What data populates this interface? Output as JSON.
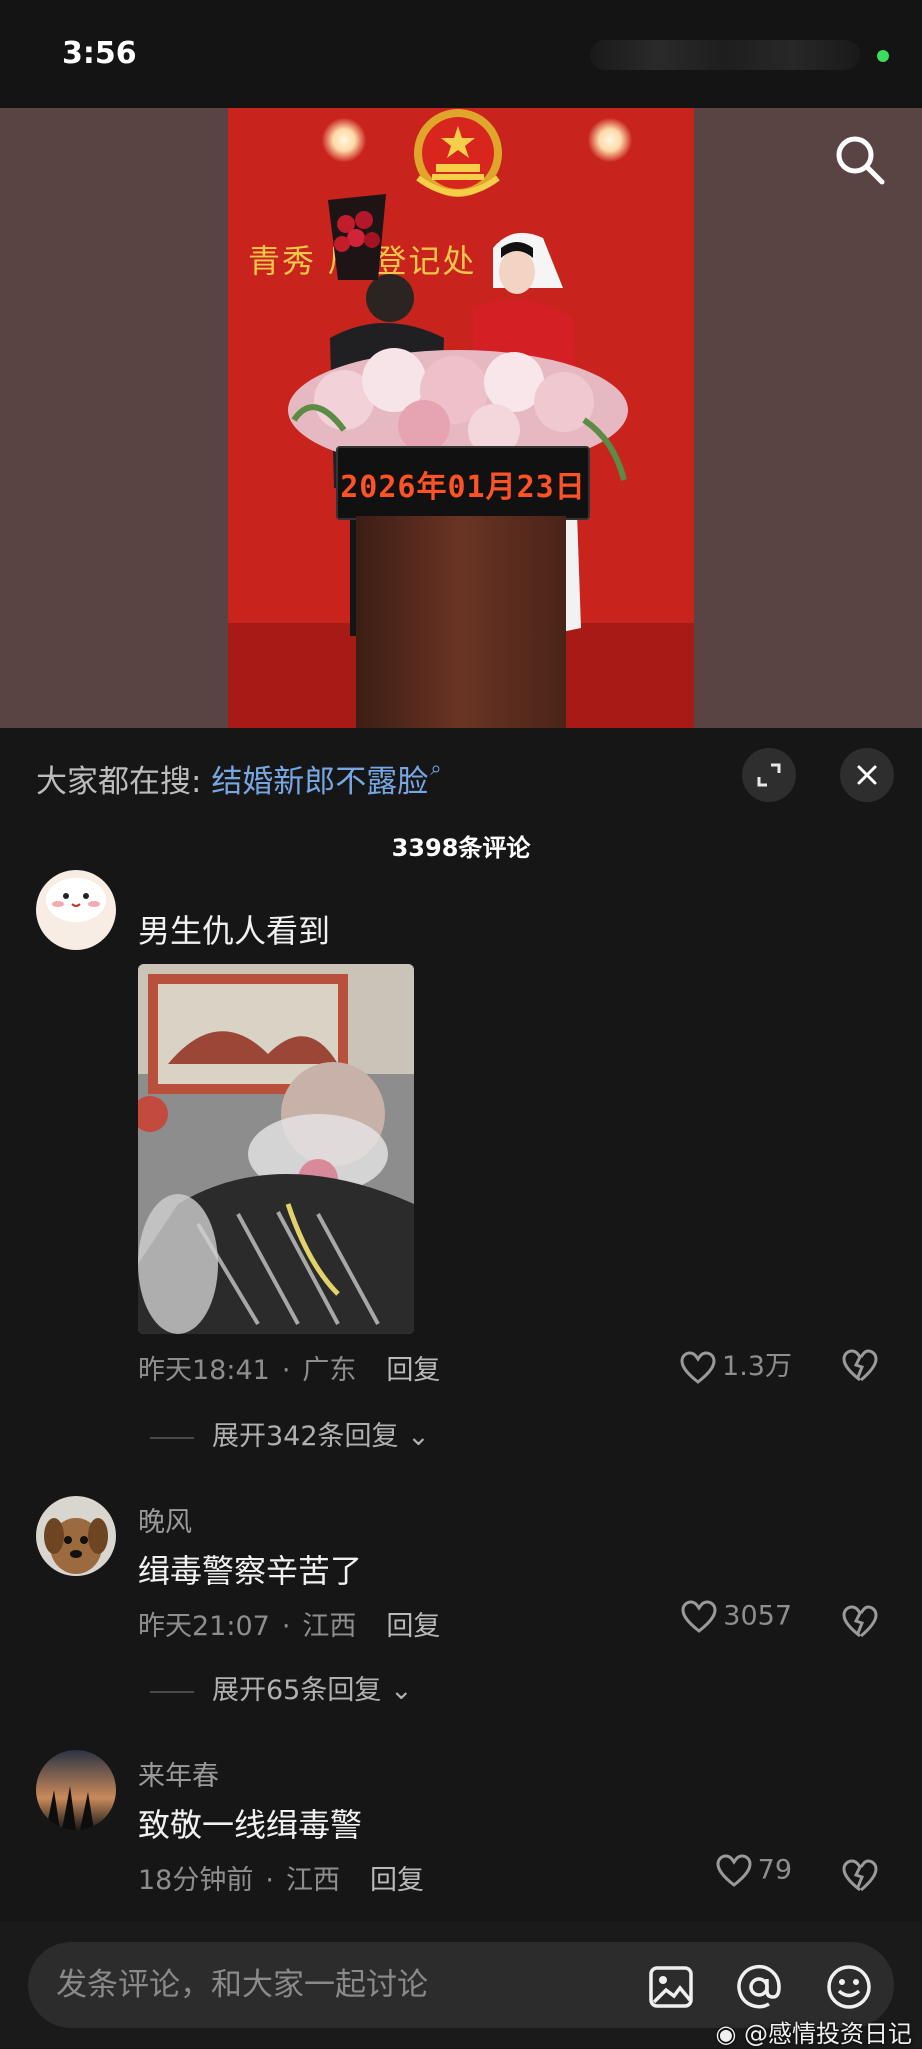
{
  "status_bar": {
    "time": "3:56"
  },
  "video": {
    "wall_sign": "青秀  局    登记处",
    "date_board": "2026年01月23日"
  },
  "sheet": {
    "trending_prefix": "大家都在搜:",
    "trending_query": "结婚新郎不露脸",
    "comment_count": "3398条评论"
  },
  "comments": [
    {
      "username": "",
      "text": "男生仇人看到",
      "time": "昨天18:41",
      "region": "广东",
      "reply_label": "回复",
      "likes": "1.3万",
      "expand_label": "展开342条回复"
    },
    {
      "username": "晚风",
      "text": "缉毒警察辛苦了",
      "time": "昨天21:07",
      "region": "江西",
      "reply_label": "回复",
      "likes": "3057",
      "expand_label": "展开65条回复"
    },
    {
      "username": "来年春",
      "text": "致敬一线缉毒警",
      "time": "18分钟前",
      "region": "江西",
      "reply_label": "回复",
      "likes": "79"
    }
  ],
  "bottom_bar": {
    "input_placeholder": "发条评论，和大家一起讨论",
    "watermark": "@感情投资日记"
  },
  "colors": {
    "background": "#161616",
    "link": "#76a7e3",
    "wall_red": "#c8231d"
  }
}
